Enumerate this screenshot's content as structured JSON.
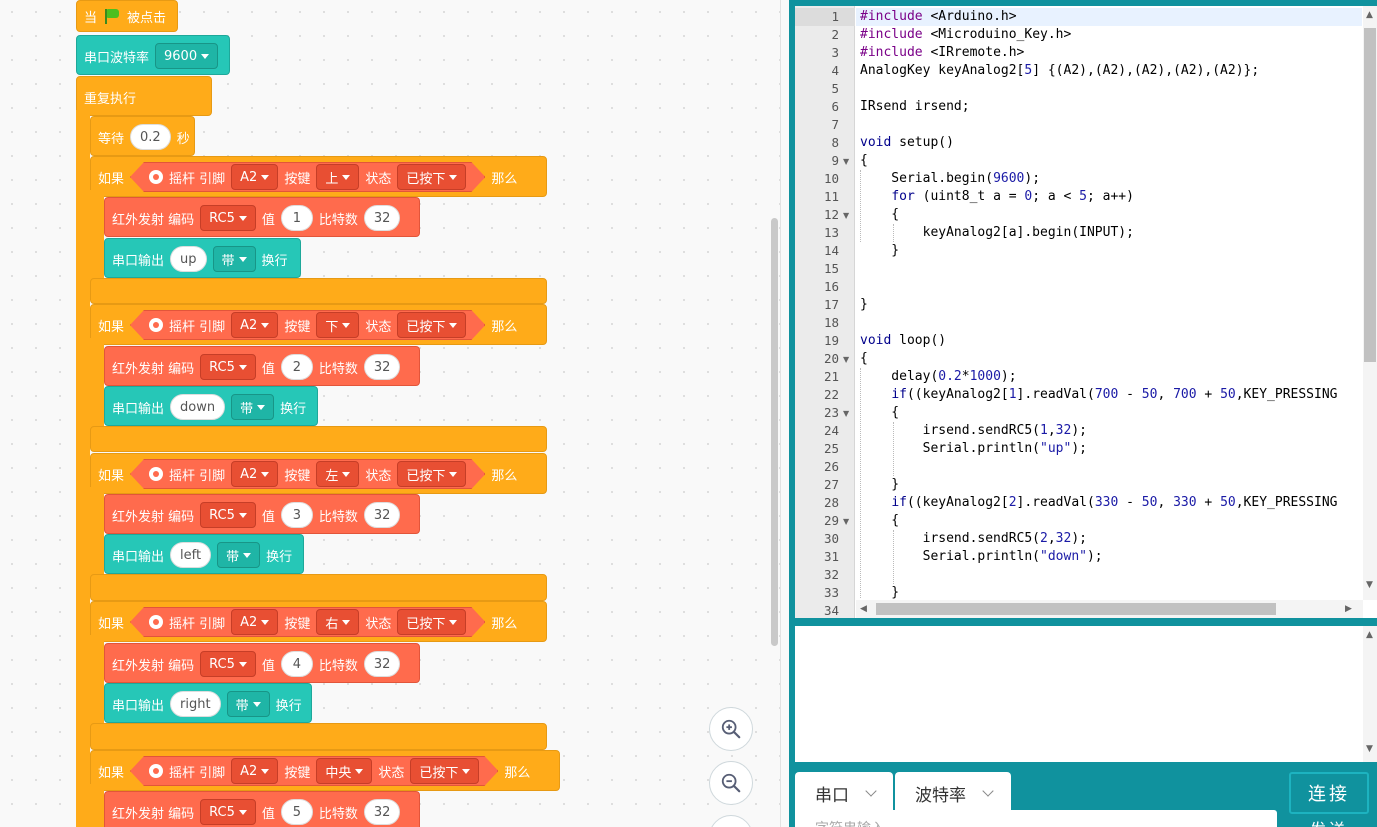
{
  "workspace": {
    "hat_when": "当",
    "hat_clicked": "被点击",
    "baud_label": "串口波特率",
    "baud_value": "9600",
    "loop_label": "重复执行",
    "wait_label": "等待",
    "wait_value": "0.2",
    "wait_unit": "秒",
    "if_label": "如果",
    "then_label": "那么",
    "joystick_label": "摇杆 引脚",
    "key_label": "按键",
    "state_label": "状态",
    "ir_label": "红外发射 编码",
    "value_label": "值",
    "bits_label": "比特数",
    "serial_out_label": "串口输出",
    "newline_label": "换行",
    "with_option": "带",
    "ifs": [
      {
        "pin": "A2",
        "key": "上",
        "state": "已按下",
        "code": "RC5",
        "value": "1",
        "bits": "32",
        "text": "up"
      },
      {
        "pin": "A2",
        "key": "下",
        "state": "已按下",
        "code": "RC5",
        "value": "2",
        "bits": "32",
        "text": "down"
      },
      {
        "pin": "A2",
        "key": "左",
        "state": "已按下",
        "code": "RC5",
        "value": "3",
        "bits": "32",
        "text": "left"
      },
      {
        "pin": "A2",
        "key": "右",
        "state": "已按下",
        "code": "RC5",
        "value": "4",
        "bits": "32",
        "text": "right"
      },
      {
        "pin": "A2",
        "key": "中央",
        "state": "已按下",
        "code": "RC5",
        "value": "5",
        "bits": "32"
      }
    ],
    "zoom_in_icon": "zoom-in-icon",
    "zoom_out_icon": "zoom-out-icon"
  },
  "editor": {
    "line_numbers": [
      "1",
      "2",
      "3",
      "4",
      "5",
      "6",
      "7",
      "8",
      "9",
      "10",
      "11",
      "12",
      "13",
      "14",
      "15",
      "16",
      "17",
      "18",
      "19",
      "20",
      "21",
      "22",
      "23",
      "24",
      "25",
      "26",
      "27",
      "28",
      "29",
      "30",
      "31",
      "32",
      "33",
      "34"
    ],
    "lines": [
      "#include <Arduino.h>",
      "#include <Microduino_Key.h>",
      "#include <IRremote.h>",
      "AnalogKey keyAnalog2[5] {(A2),(A2),(A2),(A2),(A2)};",
      "",
      "IRsend irsend;",
      "",
      "void setup()",
      "{",
      "    Serial.begin(9600);",
      "    for (uint8_t a = 0; a < 5; a++)",
      "    {",
      "        keyAnalog2[a].begin(INPUT);",
      "    }",
      "",
      "",
      "}",
      "",
      "void loop()",
      "{",
      "    delay(0.2*1000);",
      "    if((keyAnalog2[1].readVal(700 - 50, 700 + 50,KEY_PRESSING",
      "    {",
      "        irsend.sendRC5(1,32);",
      "        Serial.println(\"up\");",
      "",
      "    }",
      "    if((keyAnalog2[2].readVal(330 - 50, 330 + 50,KEY_PRESSING",
      "    {",
      "        irsend.sendRC5(2,32);",
      "        Serial.println(\"down\");",
      "",
      "    }",
      ""
    ]
  },
  "serial": {
    "port_label": "串口",
    "baud_label": "波特率",
    "connect_label": "连接",
    "input_placeholder": "字符串输入",
    "send_label": "发送"
  }
}
